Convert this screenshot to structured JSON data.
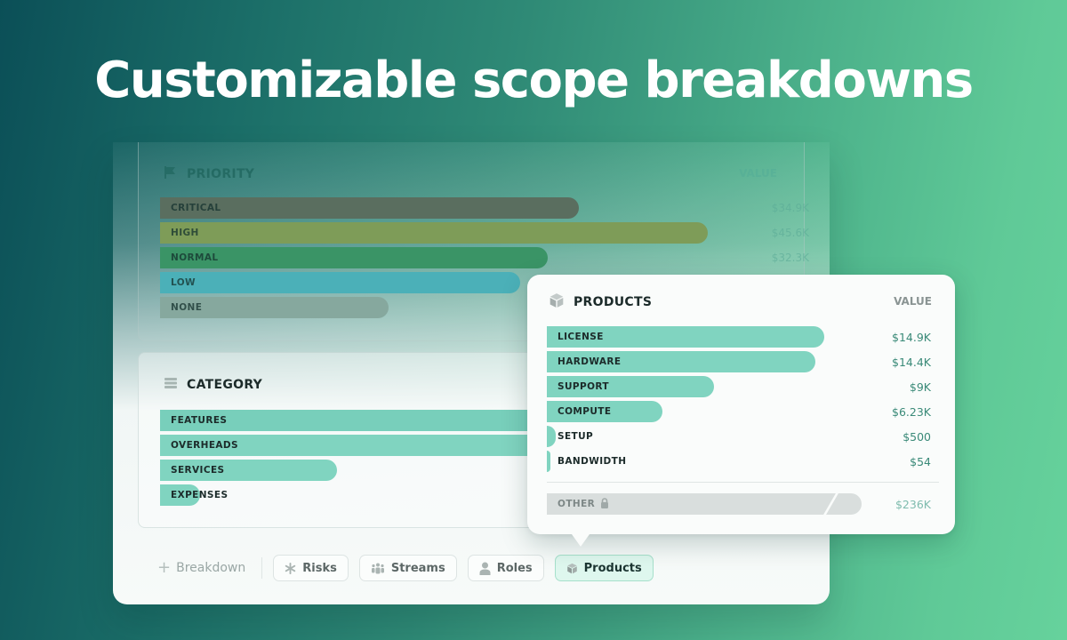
{
  "hero": {
    "title": "Customizable scope breakdowns"
  },
  "priority": {
    "title": "PRIORITY",
    "icon": "flag-icon",
    "value_header": "VALUE",
    "max": 50000,
    "items": [
      {
        "label": "CRITICAL",
        "value": 34900,
        "display": "$34.9K",
        "color": "#5a6e5f"
      },
      {
        "label": "HIGH",
        "value": 45600,
        "display": "$45.6K",
        "color": "#7e9c58"
      },
      {
        "label": "NORMAL",
        "value": 32300,
        "display": "$32.3K",
        "color": "#3a9466"
      },
      {
        "label": "LOW",
        "value": 30000,
        "display": "",
        "color": "#4bb0b8"
      },
      {
        "label": "NONE",
        "value": 19000,
        "display": "",
        "color": "#86a89e"
      }
    ]
  },
  "category": {
    "title": "CATEGORY",
    "icon": "list-icon",
    "max": 50000,
    "items": [
      {
        "label": "FEATURES",
        "value": 60000,
        "color": "#78cfbb"
      },
      {
        "label": "OVERHEADS",
        "value": 60000,
        "color": "#80d4c0"
      },
      {
        "label": "SERVICES",
        "value": 14200,
        "color": "#80d4c0"
      },
      {
        "label": "EXPENSES",
        "value": 3200,
        "color": "#80d4c0"
      }
    ]
  },
  "products": {
    "title": "PRODUCTS",
    "icon": "cube-icon",
    "value_header": "VALUE",
    "max": 16000,
    "items": [
      {
        "label": "LICENSE",
        "value": 14900,
        "display": "$14.9K"
      },
      {
        "label": "HARDWARE",
        "value": 14400,
        "display": "$14.4K"
      },
      {
        "label": "SUPPORT",
        "value": 9000,
        "display": "$9K"
      },
      {
        "label": "COMPUTE",
        "value": 6230,
        "display": "$6.23K"
      },
      {
        "label": "SETUP",
        "value": 500,
        "display": "$500"
      },
      {
        "label": "BANDWIDTH",
        "value": 54,
        "display": "$54"
      }
    ],
    "other": {
      "label": "OTHER",
      "display": "$236K",
      "locked": true
    }
  },
  "footer": {
    "add_label": "Breakdown",
    "chips": [
      {
        "label": "Risks",
        "icon": "asterisk-icon",
        "active": false
      },
      {
        "label": "Streams",
        "icon": "group-icon",
        "active": false
      },
      {
        "label": "Roles",
        "icon": "user-icon",
        "active": false
      },
      {
        "label": "Products",
        "icon": "cube-icon",
        "active": true
      }
    ]
  }
}
